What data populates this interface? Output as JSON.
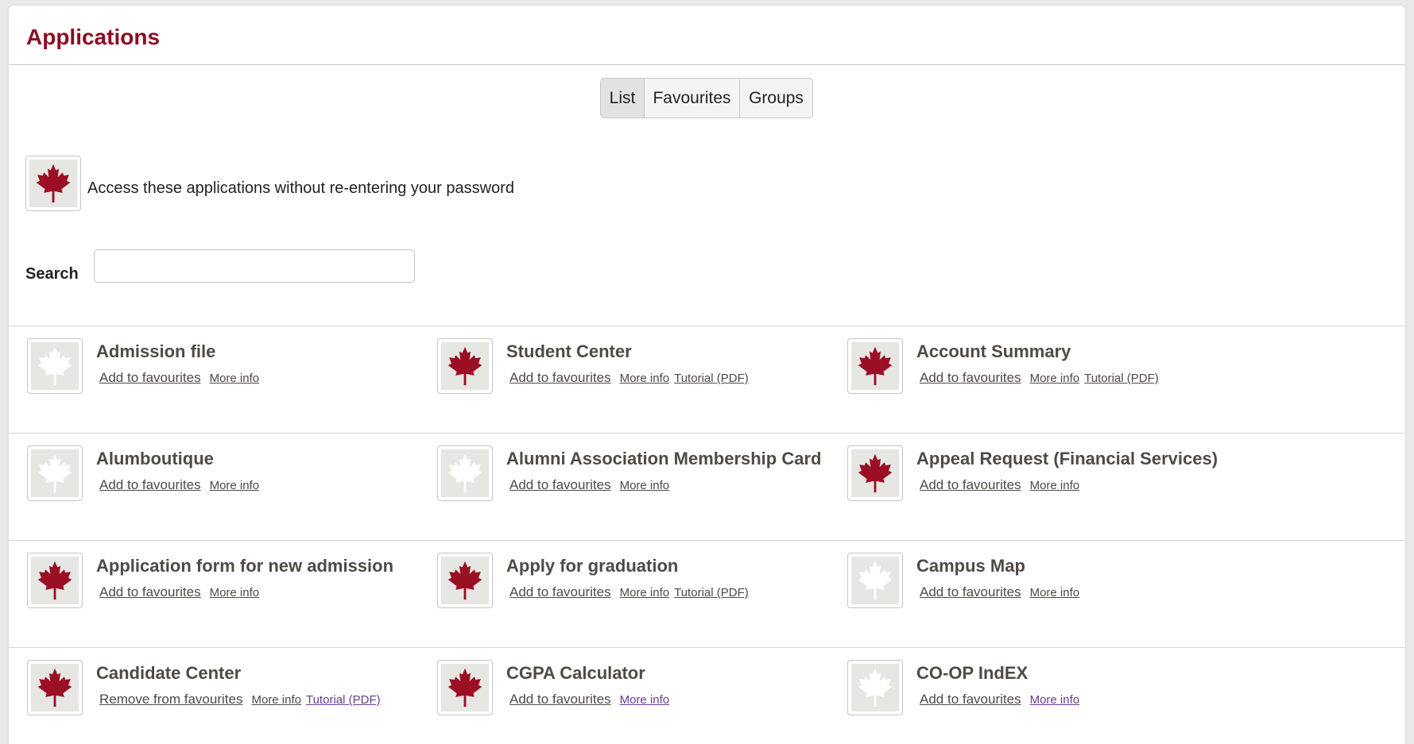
{
  "page": {
    "title": "Applications"
  },
  "tabs": [
    {
      "label": "List",
      "active": true
    },
    {
      "label": "Favourites",
      "active": false
    },
    {
      "label": "Groups",
      "active": false
    }
  ],
  "sso_note": "Access these applications without re-entering your password",
  "search": {
    "label": "Search",
    "value": "",
    "placeholder": ""
  },
  "colors": {
    "brand": "#8b0c23",
    "icon_active": "#9b0f24",
    "icon_inactive": "#ffffff"
  },
  "apps": [
    {
      "name": "Admission file",
      "fav_label": "Add to favourites",
      "more_info": "More info",
      "tutorial": "",
      "icon": "maple-leaf-icon",
      "icon_active": false
    },
    {
      "name": "Student Center",
      "fav_label": "Add to favourites",
      "more_info": "More info",
      "tutorial": "Tutorial (PDF)",
      "icon": "maple-leaf-icon",
      "icon_active": true
    },
    {
      "name": "Account Summary",
      "fav_label": "Add to favourites",
      "more_info": "More info",
      "tutorial": "Tutorial (PDF)",
      "icon": "maple-leaf-icon",
      "icon_active": true
    },
    {
      "name": "Alumboutique",
      "fav_label": "Add to favourites",
      "more_info": "More info",
      "tutorial": "",
      "icon": "maple-leaf-icon",
      "icon_active": false
    },
    {
      "name": "Alumni Association Membership Card",
      "fav_label": "Add to favourites",
      "more_info": "More info",
      "tutorial": "",
      "icon": "maple-leaf-icon",
      "icon_active": false
    },
    {
      "name": "Appeal Request (Financial Services)",
      "fav_label": "Add to favourites",
      "more_info": "More info",
      "tutorial": "",
      "icon": "maple-leaf-icon",
      "icon_active": true
    },
    {
      "name": "Application form for new admission",
      "fav_label": "Add to favourites",
      "more_info": "More info",
      "tutorial": "",
      "icon": "maple-leaf-icon",
      "icon_active": true
    },
    {
      "name": "Apply for graduation",
      "fav_label": "Add to favourites",
      "more_info": "More info",
      "tutorial": "Tutorial (PDF)",
      "icon": "maple-leaf-icon",
      "icon_active": true
    },
    {
      "name": "Campus Map",
      "fav_label": "Add to favourites",
      "more_info": "More info",
      "tutorial": "",
      "icon": "maple-leaf-icon",
      "icon_active": false
    },
    {
      "name": "Candidate Center",
      "fav_label": "Remove from favourites",
      "more_info": "More info",
      "tutorial": "Tutorial (PDF)",
      "icon": "maple-leaf-icon",
      "icon_active": true
    },
    {
      "name": "CGPA Calculator",
      "fav_label": "Add to favourites",
      "more_info": "More info",
      "tutorial": "",
      "icon": "maple-leaf-icon",
      "icon_active": true
    },
    {
      "name": "CO-OP IndEX",
      "fav_label": "Add to favourites",
      "more_info": "More info",
      "tutorial": "",
      "icon": "maple-leaf-icon",
      "icon_active": false
    }
  ]
}
